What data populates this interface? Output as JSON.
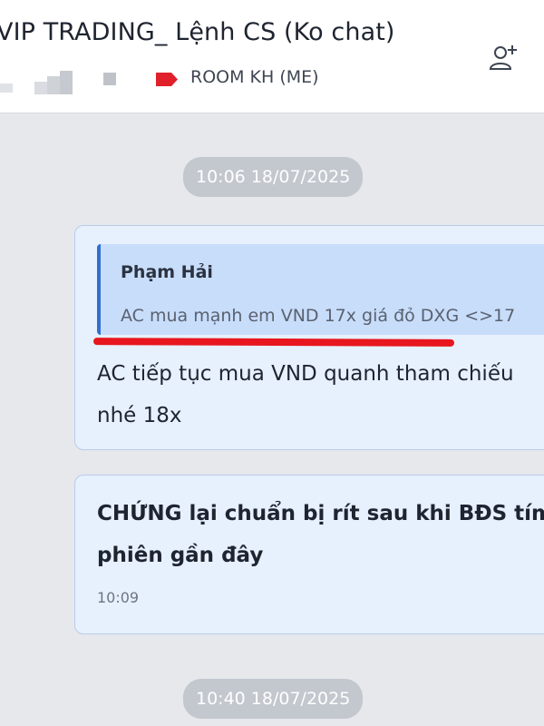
{
  "header": {
    "title": "VIP TRADING_ Lệnh CS (Ko chat)",
    "room_label": "ROOM KH (ME)",
    "tag_color": "#e0202a",
    "add_member_icon": "add-member-icon"
  },
  "chat": {
    "date_separators": [
      "10:06 18/07/2025",
      "10:40 18/07/2025"
    ],
    "messages": [
      {
        "quote_author": "Phạm Hải",
        "quote_text": "AC mua mạnh em VND 17x giá đỏ DXG <>17",
        "text_line1": "AC tiếp tục mua VND quanh tham chiếu",
        "text_line2": "nhé 18x"
      },
      {
        "text_line1": "CHỨNG lại chuẩn bị rít sau khi BĐS tím",
        "text_line2": "phiên gần đây",
        "time": "10:09"
      }
    ]
  },
  "colors": {
    "bubble_bg": "#e7f0fd",
    "quote_bg": "#c8ddfa",
    "quote_bar": "#2f6fd0",
    "annotation_underline": "#e8161f",
    "chat_bg": "#e6e8ec"
  }
}
